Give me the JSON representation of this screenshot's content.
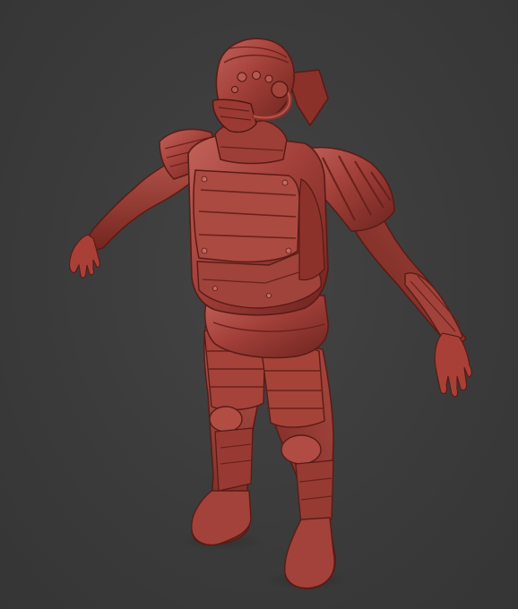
{
  "scene": {
    "subject": "armored-humanoid-sculpt",
    "colors": {
      "background": "#3a3a3a",
      "clay_base": "#9e3a33",
      "clay_light": "#c8685c",
      "clay_dark": "#5c1c18",
      "clay_shadow": "#3e1210"
    }
  }
}
